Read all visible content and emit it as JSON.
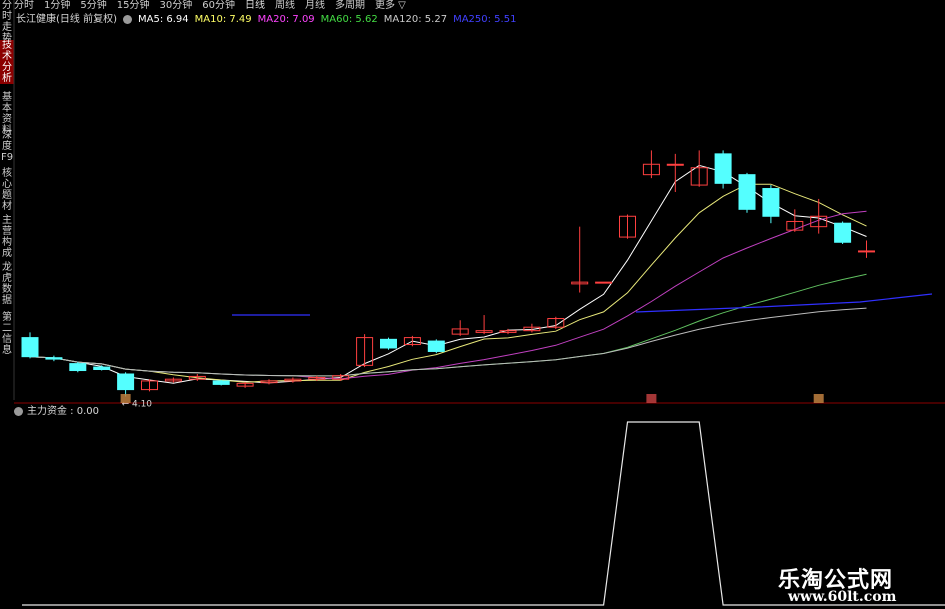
{
  "toolbar": {
    "tabs": [
      "分时",
      "1分钟",
      "5分钟",
      "15分钟",
      "30分钟",
      "60分钟",
      "日线",
      "周线",
      "月线",
      "多周期",
      "更多 ▽"
    ],
    "active_tab": "日线"
  },
  "sidebar": {
    "items": [
      "分时走势",
      "技术分析",
      "基本资料",
      "深度F9",
      "核心题材",
      "主营构成",
      "龙虎数据",
      "第二信息"
    ],
    "active": "技术分析"
  },
  "header": {
    "stock_name": "长江健康(日线 前复权)",
    "ma": [
      {
        "label": "MA5: 6.94",
        "color": "#ffffff"
      },
      {
        "label": "MA10: 7.49",
        "color": "#ffff66"
      },
      {
        "label": "MA20: 7.09",
        "color": "#ff44ff"
      },
      {
        "label": "MA60: 5.62",
        "color": "#44dd44"
      },
      {
        "label": "MA120: 5.27",
        "color": "#cccccc"
      },
      {
        "label": "MA250: 5.51",
        "color": "#4040ff"
      }
    ]
  },
  "indicator": {
    "label": "主力资金 : 0.00"
  },
  "colors": {
    "up": "#ff4040",
    "down": "#54ffff",
    "separator": "#8b0000",
    "ma5": "#ffffff",
    "ma10": "#e8e87a",
    "ma20": "#c040c0",
    "ma60": "#60c060",
    "ma120": "#bbbbbb",
    "ma250": "#3030ff"
  },
  "chart_data": {
    "type": "candlestick",
    "low_label": "4.10",
    "candles": [
      {
        "o": 5.8,
        "c": 5.25,
        "h": 5.95,
        "l": 5.2
      },
      {
        "o": 5.22,
        "c": 5.18,
        "h": 5.28,
        "l": 5.12
      },
      {
        "o": 5.05,
        "c": 4.85,
        "h": 5.1,
        "l": 4.8
      },
      {
        "o": 4.95,
        "c": 4.88,
        "h": 5.0,
        "l": 4.85
      },
      {
        "o": 4.75,
        "c": 4.3,
        "h": 4.8,
        "l": 4.1
      },
      {
        "o": 4.3,
        "c": 4.55,
        "h": 4.6,
        "l": 4.25
      },
      {
        "o": 4.55,
        "c": 4.6,
        "h": 4.65,
        "l": 4.5
      },
      {
        "o": 4.6,
        "c": 4.68,
        "h": 4.75,
        "l": 4.55
      },
      {
        "o": 4.55,
        "c": 4.45,
        "h": 4.58,
        "l": 4.42
      },
      {
        "o": 4.4,
        "c": 4.48,
        "h": 4.52,
        "l": 4.35
      },
      {
        "o": 4.5,
        "c": 4.55,
        "h": 4.6,
        "l": 4.45
      },
      {
        "o": 4.55,
        "c": 4.6,
        "h": 4.65,
        "l": 4.5
      },
      {
        "o": 4.6,
        "c": 4.65,
        "h": 4.7,
        "l": 4.55
      },
      {
        "o": 4.6,
        "c": 4.7,
        "h": 4.75,
        "l": 4.55
      },
      {
        "o": 5.0,
        "c": 5.8,
        "h": 5.9,
        "l": 4.95
      },
      {
        "o": 5.75,
        "c": 5.5,
        "h": 5.8,
        "l": 5.45
      },
      {
        "o": 5.6,
        "c": 5.8,
        "h": 5.85,
        "l": 5.55
      },
      {
        "o": 5.7,
        "c": 5.4,
        "h": 5.75,
        "l": 5.35
      },
      {
        "o": 5.9,
        "c": 6.05,
        "h": 6.3,
        "l": 5.85
      },
      {
        "o": 5.95,
        "c": 6.0,
        "h": 6.45,
        "l": 5.9
      },
      {
        "o": 5.95,
        "c": 6.0,
        "h": 6.05,
        "l": 5.9
      },
      {
        "o": 6.0,
        "c": 6.1,
        "h": 6.2,
        "l": 5.95
      },
      {
        "o": 6.1,
        "c": 6.35,
        "h": 6.4,
        "l": 6.05
      },
      {
        "o": 7.35,
        "c": 7.4,
        "h": 9.0,
        "l": 7.1
      },
      {
        "o": 7.4,
        "c": 7.4,
        "h": 7.4,
        "l": 7.4
      },
      {
        "o": 8.7,
        "c": 9.3,
        "h": 9.35,
        "l": 8.65
      },
      {
        "o": 10.5,
        "c": 10.8,
        "h": 11.2,
        "l": 10.4
      },
      {
        "o": 10.8,
        "c": 10.8,
        "h": 11.1,
        "l": 10.0
      },
      {
        "o": 10.2,
        "c": 10.7,
        "h": 11.2,
        "l": 10.15
      },
      {
        "o": 11.1,
        "c": 10.25,
        "h": 11.2,
        "l": 10.1
      },
      {
        "o": 10.5,
        "c": 9.5,
        "h": 10.55,
        "l": 9.4
      },
      {
        "o": 10.1,
        "c": 9.3,
        "h": 10.2,
        "l": 9.1
      },
      {
        "o": 8.9,
        "c": 9.15,
        "h": 9.5,
        "l": 8.85
      },
      {
        "o": 9.0,
        "c": 9.3,
        "h": 9.8,
        "l": 8.8
      },
      {
        "o": 9.1,
        "c": 8.55,
        "h": 9.15,
        "l": 8.5
      },
      {
        "o": 8.3,
        "c": 8.3,
        "h": 8.6,
        "l": 8.1
      }
    ],
    "main_fund": [
      0,
      0,
      0,
      0,
      0,
      0,
      0,
      0,
      0,
      0,
      0,
      0,
      0,
      0,
      0,
      0,
      0,
      0,
      0,
      0,
      0,
      0,
      0,
      0,
      0,
      1,
      1,
      1,
      1,
      0,
      0,
      0,
      0,
      0,
      0,
      0
    ]
  },
  "watermark": {
    "cn": "乐淘公式网",
    "url": "www.60lt.com"
  }
}
